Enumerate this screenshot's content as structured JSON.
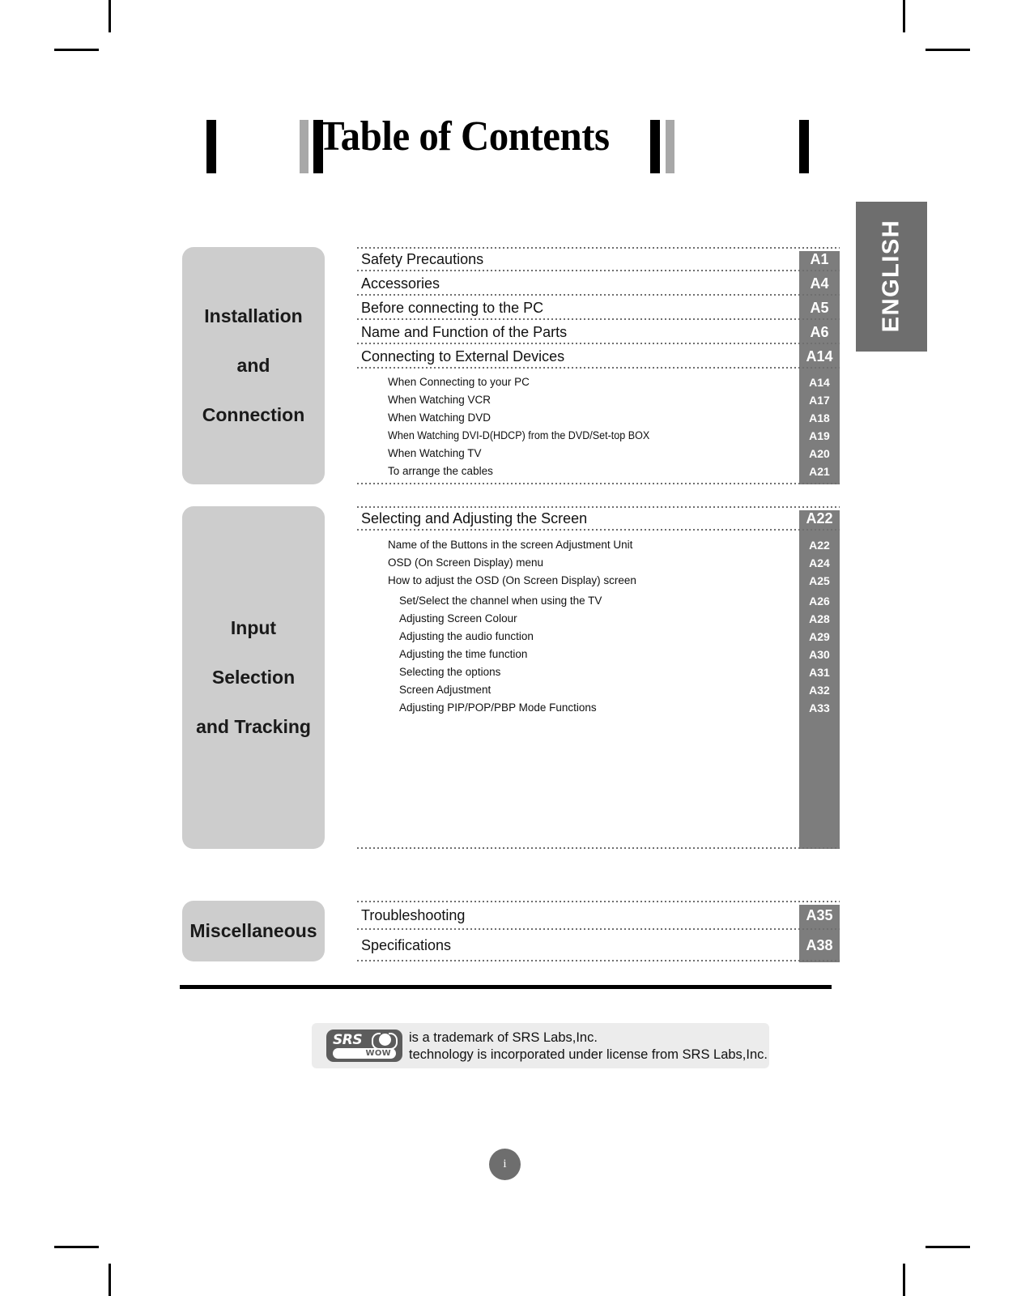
{
  "heading": {
    "title": "Table of Contents"
  },
  "side_tab": {
    "label": "ENGLISH"
  },
  "footer": {
    "page": "i"
  },
  "sections": [
    {
      "category": "Installation\nand\nConnection",
      "category_lines": [
        "Installation",
        "and",
        "Connection"
      ],
      "rows": [
        {
          "label": "Safety Precautions",
          "page": "A1"
        },
        {
          "label": "Accessories",
          "page": "A4"
        },
        {
          "label": "Before connecting to the PC",
          "page": "A5"
        },
        {
          "label": "Name and Function of the Parts",
          "page": "A6"
        },
        {
          "label": "Connecting to External Devices",
          "page": "A14"
        }
      ],
      "subrows": [
        {
          "label": "When Connecting to your PC",
          "page": "A14",
          "indent": 1
        },
        {
          "label": "When Watching VCR",
          "page": "A17",
          "indent": 1
        },
        {
          "label": "When Watching DVD",
          "page": "A18",
          "indent": 1
        },
        {
          "label": "When Watching DVI-D(HDCP) from the DVD/Set-top BOX",
          "page": "A19",
          "indent": 1,
          "condensed": true
        },
        {
          "label": "When Watching TV",
          "page": "A20",
          "indent": 1
        },
        {
          "label": "To arrange the cables",
          "page": "A21",
          "indent": 1
        }
      ]
    },
    {
      "category": "Input\nSelection\nand Tracking",
      "category_lines": [
        "Input",
        "Selection",
        "and Tracking"
      ],
      "rows": [
        {
          "label": "Selecting and Adjusting the Screen",
          "page": "A22"
        }
      ],
      "subrows": [
        {
          "label": "Name of the Buttons in the screen Adjustment Unit",
          "page": "A22",
          "indent": 1
        },
        {
          "label": "OSD (On Screen Display) menu",
          "page": "A24",
          "indent": 1
        },
        {
          "label": "How to adjust the OSD (On Screen Display) screen",
          "page": "A25",
          "indent": 1
        },
        {
          "label": "Set/Select the channel when using the TV",
          "page": "A26",
          "indent": 2
        },
        {
          "label": "Adjusting Screen Colour",
          "page": "A28",
          "indent": 2
        },
        {
          "label": "Adjusting the audio function",
          "page": "A29",
          "indent": 2
        },
        {
          "label": "Adjusting the time function",
          "page": "A30",
          "indent": 2
        },
        {
          "label": "Selecting the options",
          "page": "A31",
          "indent": 2
        },
        {
          "label": "Screen Adjustment",
          "page": "A32",
          "indent": 2
        },
        {
          "label": "Adjusting PIP/POP/PBP Mode Functions",
          "page": "A33",
          "indent": 2
        }
      ]
    },
    {
      "category": "Miscellaneous",
      "category_lines": [
        "Miscellaneous"
      ],
      "rows": [
        {
          "label": "Troubleshooting",
          "page": "A35"
        },
        {
          "label": "Specifications",
          "page": "A38"
        }
      ],
      "subrows": []
    }
  ],
  "srs_notice": {
    "logo_word": "SRS",
    "logo_sub": "WOW",
    "line1": "is a trademark of SRS Labs,Inc.",
    "line2": "technology is incorporated under license from SRS Labs,Inc."
  },
  "colors": {
    "category_bg": "#cdcdcd",
    "page_column_bg": "#7d7d7d",
    "side_tab_bg": "#6e6e6e",
    "dot_leader": "#6f6f6f",
    "srs_notice_bg": "#ececec",
    "srs_logo_bg": "#5c5c5c"
  }
}
